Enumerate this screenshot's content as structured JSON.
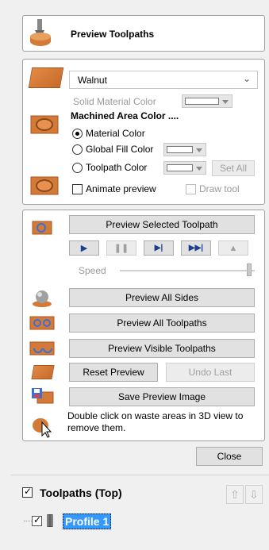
{
  "header": {
    "title": "Preview Toolpaths"
  },
  "material": {
    "selected": "Walnut",
    "solid_color_label": "Solid Material Color",
    "machined_heading": "Machined Area Color ....",
    "radio_material": "Material Color",
    "radio_global": "Global Fill Color",
    "radio_toolpath": "Toolpath Color",
    "set_all": "Set All",
    "animate_label": "Animate preview",
    "draw_tool_label": "Draw tool"
  },
  "preview": {
    "preview_selected": "Preview Selected Toolpath",
    "speed_label": "Speed",
    "preview_all_sides": "Preview All Sides",
    "preview_all_toolpaths": "Preview All Toolpaths",
    "preview_visible": "Preview Visible Toolpaths",
    "reset_preview": "Reset Preview",
    "undo_last": "Undo Last",
    "save_image": "Save Preview Image",
    "hint": "Double click on waste areas in 3D view to remove them."
  },
  "close_label": "Close",
  "toolpaths": {
    "title": "Toolpaths (Top)",
    "items": [
      {
        "name": "Profile 1",
        "checked": true
      }
    ]
  },
  "colors": {
    "accent": "#1e5fd4",
    "selection": "#3399ff",
    "wood": "#d47a38"
  }
}
